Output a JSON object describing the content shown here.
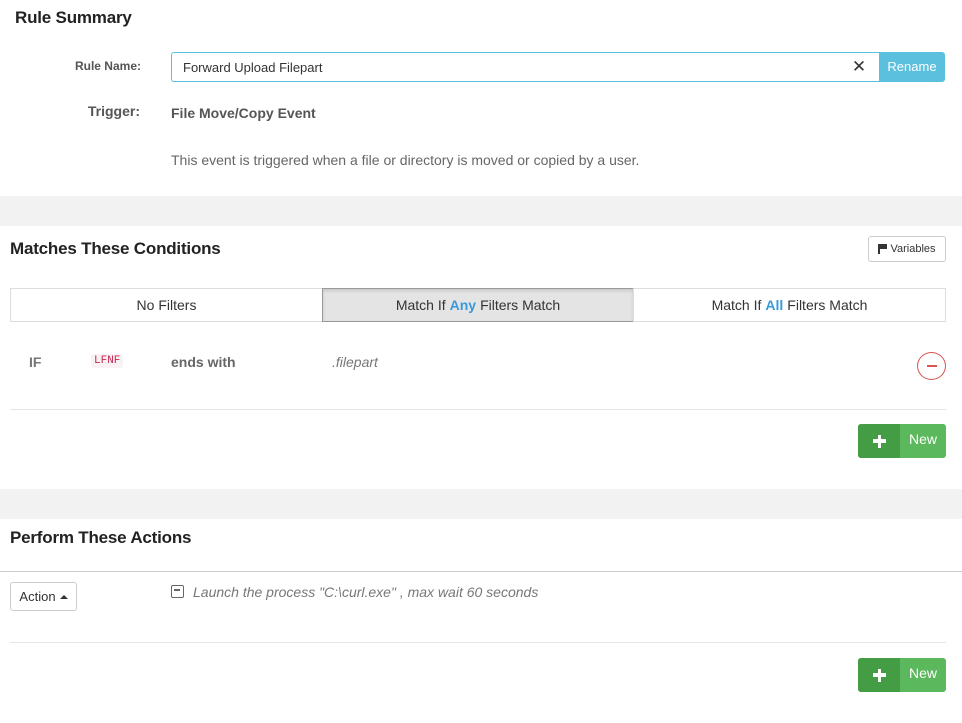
{
  "summary": {
    "title": "Rule Summary",
    "rule_name_label": "Rule Name:",
    "rule_name_value": "Forward Upload Filepart",
    "clear_symbol": "✕",
    "rename_label": "Rename",
    "trigger_label": "Trigger:",
    "trigger_value": "File Move/Copy Event",
    "trigger_description": "This event is triggered when a file or directory is moved or copied by a user."
  },
  "conditions": {
    "title": "Matches These Conditions",
    "variables_label": "Variables",
    "match_modes": {
      "none": "No Filters",
      "any_prefix": "Match If",
      "any_keyword": "Any",
      "any_suffix": "Filters Match",
      "all_prefix": "Match If",
      "all_keyword": "All",
      "all_suffix": "Filters Match",
      "selected": "any"
    },
    "rules": [
      {
        "keyword": "IF",
        "variable": "LFNF",
        "operator": "ends with",
        "value": ".filepart"
      }
    ],
    "new_label": "New"
  },
  "actions": {
    "title": "Perform These Actions",
    "action_menu_label": "Action",
    "items": [
      {
        "icon": "process-icon",
        "text": "Launch the process \"C:\\curl.exe\" , max wait 60 seconds"
      }
    ],
    "new_label": "New"
  },
  "colors": {
    "accent_info": "#5bc0de",
    "accent_success": "#5cb85c",
    "accent_danger": "#d9534f",
    "highlight_blue": "#3a9ad9",
    "variable_badge": "#c7254e"
  }
}
